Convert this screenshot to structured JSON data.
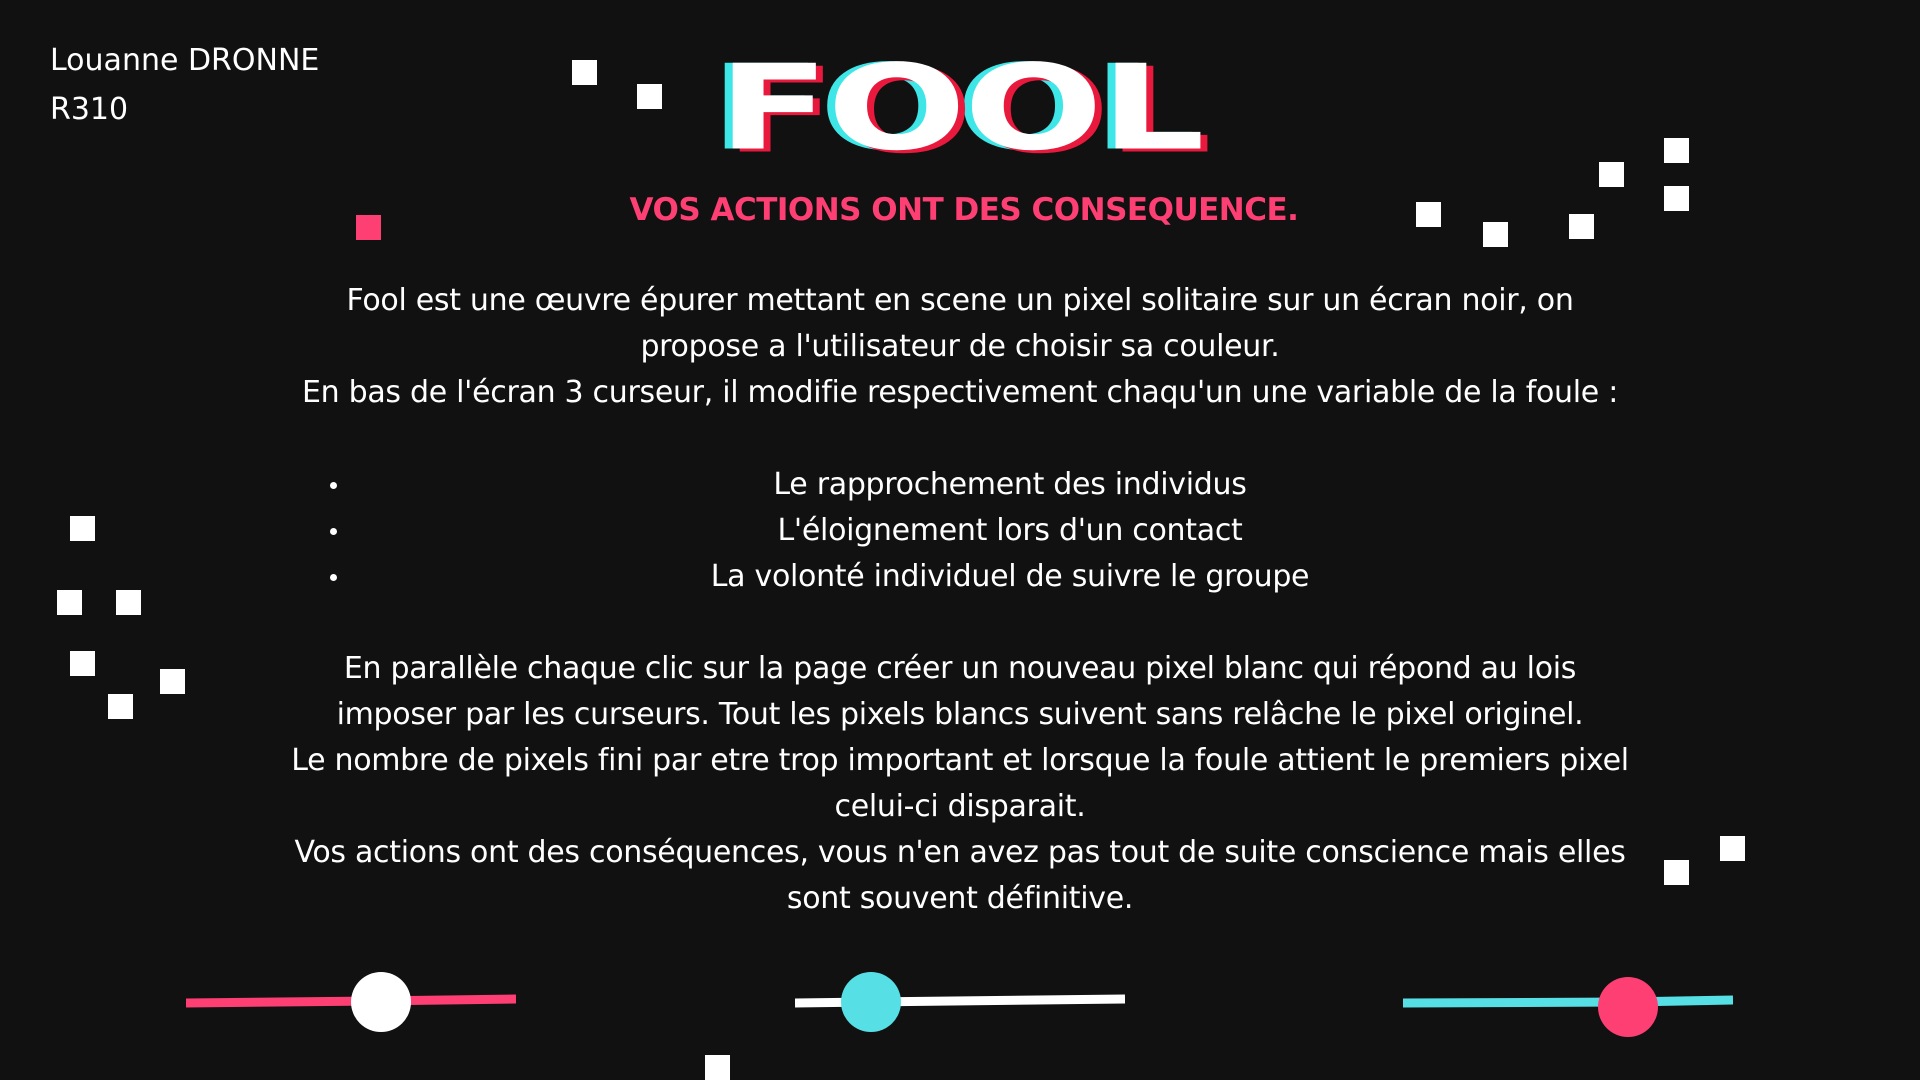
{
  "author": {
    "name": "Louanne DRONNE",
    "course": "R310"
  },
  "title": "FOOL",
  "subtitle": "VOS ACTIONS ONT DES CONSEQUENCE.",
  "description": {
    "line1": "Fool est une œuvre épurer mettant en scene un pixel solitaire sur un écran noir, on propose a l'utilisateur de choisir sa couleur.",
    "line2": "En bas de l'écran 3 curseur, il modifie respectivement chaqu'un une variable de la foule :",
    "bullets": [
      "Le rapprochement des individus",
      "L'éloignement lors d'un contact",
      "La volonté individuel de suivre le groupe"
    ],
    "para2_line1": "En parallèle chaque clic sur la page créer un nouveau pixel blanc qui répond au lois imposer par les curseurs. Tout les pixels blancs suivent sans relâche le pixel originel.",
    "para2_line2": "Le nombre de pixels fini par etre trop important et lorsque la foule attient le premiers pixel celui-ci disparait.",
    "para2_line3": "Vos actions ont des conséquences, vous n'en avez pas tout de suite conscience mais elles sont souvent définitive."
  },
  "sliders": [
    {
      "name": "rapprochement",
      "value": 0.59,
      "track_left": "#fd3f73",
      "track_right": "#fd3f73",
      "knob": "#ffffff"
    },
    {
      "name": "eloignement",
      "value": 0.23,
      "track_left": "#ffffff",
      "track_right": "#ffffff",
      "knob": "#56dfe4"
    },
    {
      "name": "suivre",
      "value": 0.68,
      "track_left": "#56dfe4",
      "track_right": "#56dfe4",
      "knob": "#fd3f73"
    }
  ],
  "colors": {
    "background": "#111111",
    "pink": "#fd3f73",
    "cyan": "#56dfe4",
    "white": "#ffffff"
  }
}
